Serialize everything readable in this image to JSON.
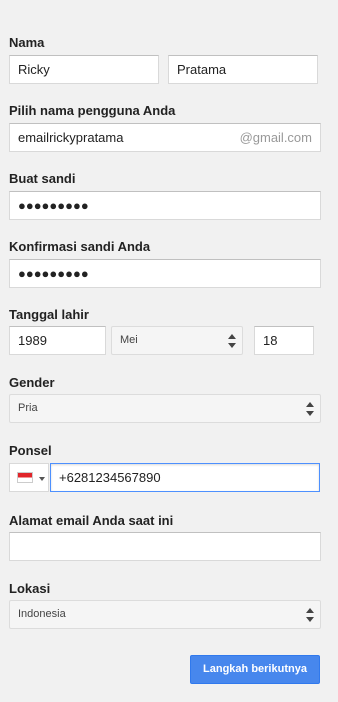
{
  "name": {
    "label": "Nama",
    "first": "Ricky",
    "last": "Pratama"
  },
  "username": {
    "label": "Pilih nama pengguna Anda",
    "value": "emailrickypratama",
    "suffix": "@gmail.com"
  },
  "password": {
    "label": "Buat sandi",
    "value": "●●●●●●●●●"
  },
  "confirm": {
    "label": "Konfirmasi sandi Anda",
    "value": "●●●●●●●●●"
  },
  "birthday": {
    "label": "Tanggal lahir",
    "year": "1989",
    "month": "Mei",
    "day": "18"
  },
  "gender": {
    "label": "Gender",
    "value": "Pria"
  },
  "phone": {
    "label": "Ponsel",
    "value": "+6281234567890",
    "flag_icon": "indonesia-flag-icon"
  },
  "current_email": {
    "label": "Alamat email Anda saat ini",
    "value": ""
  },
  "location": {
    "label": "Lokasi",
    "value": "Indonesia"
  },
  "next_button": {
    "label": "Langkah berikutnya",
    "color": "#4787ed"
  }
}
